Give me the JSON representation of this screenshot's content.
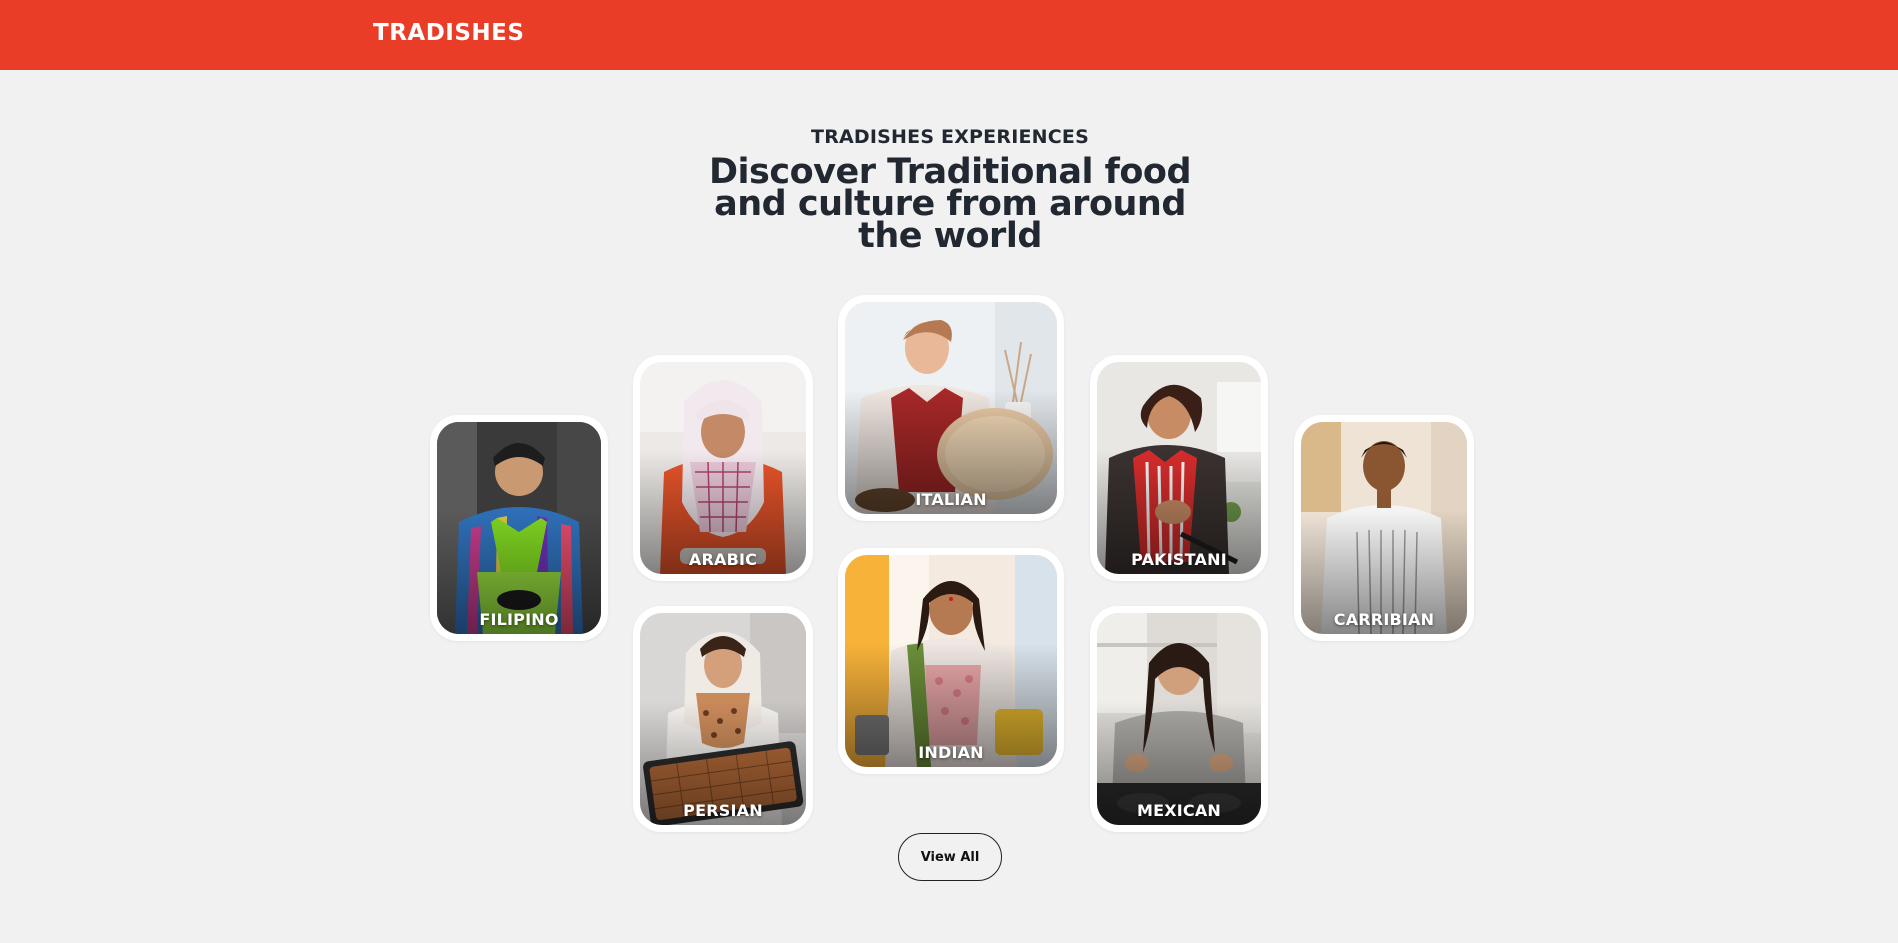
{
  "header": {
    "brand": "TRADISHES",
    "bar_color": "#e93d27"
  },
  "hero": {
    "eyebrow": "TRADISHES EXPERIENCES",
    "title_line1": "Discover Traditional food",
    "title_line2": "and culture from around",
    "title_line3": "the world"
  },
  "cuisines": [
    {
      "label": "FILIPINO"
    },
    {
      "label": "ARABIC"
    },
    {
      "label": "PERSIAN"
    },
    {
      "label": "ITALIAN"
    },
    {
      "label": "INDIAN"
    },
    {
      "label": "PAKISTANI"
    },
    {
      "label": "MEXICAN"
    },
    {
      "label": "CARRIBIAN"
    }
  ],
  "actions": {
    "view_all": "View All"
  }
}
